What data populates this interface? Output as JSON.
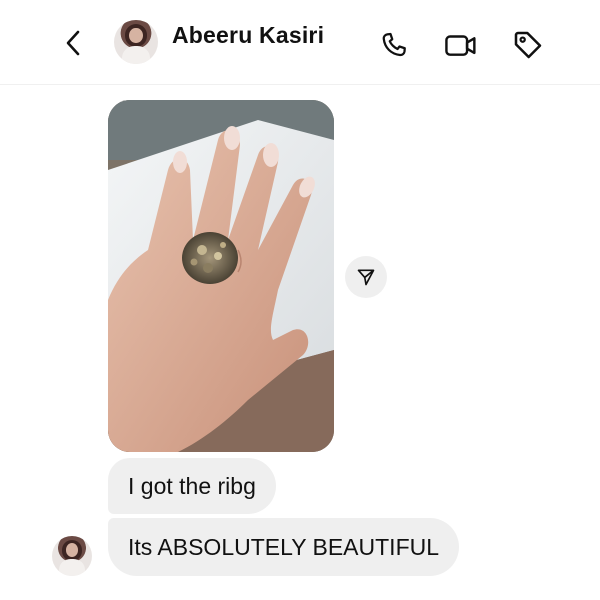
{
  "header": {
    "contact_name": "Abeeru Kasiri",
    "icons": [
      "back-chevron-icon",
      "phone-icon",
      "video-call-icon",
      "tag-icon"
    ]
  },
  "thread": {
    "photo_description_icon": "ring-photo",
    "share_icon": "send-icon",
    "messages": [
      {
        "text": "I got the ribg"
      },
      {
        "text": "Its ABSOLUTELY BEAUTIFUL"
      }
    ]
  },
  "colors": {
    "bubble": "#efefef",
    "text": "#111111",
    "background": "#ffffff"
  }
}
